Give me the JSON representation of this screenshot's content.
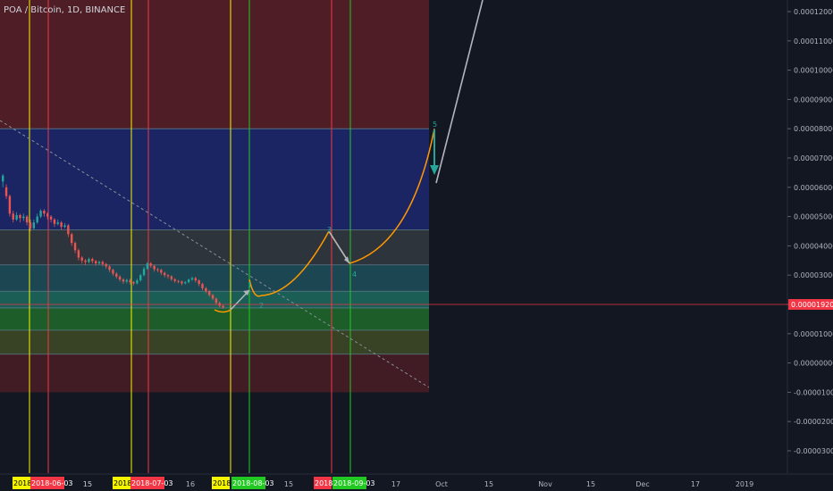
{
  "title": "POA / Bitcoin, 1D, BINANCE",
  "current_price_label": "0.00001920",
  "chart_data": {
    "type": "candlestick",
    "title": "POA / Bitcoin, 1D, BINANCE",
    "ylim": [
      -3.5e-05,
      0.000125
    ],
    "y_ticks": [
      {
        "value": 0.00012,
        "label": "0.00012000"
      },
      {
        "value": 0.00011,
        "label": "0.00011000"
      },
      {
        "value": 0.0001,
        "label": "0.00010000"
      },
      {
        "value": 9e-05,
        "label": "0.00009000"
      },
      {
        "value": 8e-05,
        "label": "0.00008000"
      },
      {
        "value": 7e-05,
        "label": "0.00007000"
      },
      {
        "value": 6e-05,
        "label": "0.00006000"
      },
      {
        "value": 5e-05,
        "label": "0.00005000"
      },
      {
        "value": 4e-05,
        "label": "0.00004000"
      },
      {
        "value": 3e-05,
        "label": "0.00003000"
      },
      {
        "value": 2e-05,
        "label": "0.00002000"
      },
      {
        "value": 1e-05,
        "label": "0.00001000"
      },
      {
        "value": 0.0,
        "label": "0.00000000"
      },
      {
        "value": -1e-05,
        "label": "-0.00001000"
      },
      {
        "value": -2e-05,
        "label": "-0.00002000"
      },
      {
        "value": -3e-05,
        "label": "-0.00003000"
      }
    ],
    "x_ticks": [
      "15",
      "15",
      "16",
      "15",
      "17",
      "Oct",
      "15",
      "Nov",
      "15",
      "Dec",
      "17",
      "2019"
    ],
    "date_chips": [
      {
        "label": "2018-",
        "color": "#f5f500",
        "text_color": "#000000"
      },
      {
        "label": "2018-06-03",
        "color": "#f23645",
        "text_color": "#ffffff"
      },
      {
        "label": "2018-",
        "color": "#f5f500",
        "text_color": "#000000"
      },
      {
        "label": "2018-07-03",
        "color": "#f23645",
        "text_color": "#ffffff"
      },
      {
        "label": "2018-",
        "color": "#f5f500",
        "text_color": "#000000"
      },
      {
        "label": "2018-08-03",
        "color": "#22c922",
        "text_color": "#ffffff"
      },
      {
        "label": "2018-",
        "color": "#f23645",
        "text_color": "#ffffff"
      },
      {
        "label": "2018-09-03",
        "color": "#22c922",
        "text_color": "#ffffff"
      }
    ],
    "zones": [
      {
        "from": 8e-05,
        "to": 0.000125,
        "color": "#5a1f26"
      },
      {
        "from": 4.55e-05,
        "to": 8e-05,
        "color": "#1f2870"
      },
      {
        "from": 3.35e-05,
        "to": 4.55e-05,
        "color": "#34393f"
      },
      {
        "from": 2.45e-05,
        "to": 3.35e-05,
        "color": "#1e4f5a"
      },
      {
        "from": 1.88e-05,
        "to": 2.45e-05,
        "color": "#1c6b5f"
      },
      {
        "from": 1.12e-05,
        "to": 1.88e-05,
        "color": "#1f6a2a"
      },
      {
        "from": 3e-06,
        "to": 1.12e-05,
        "color": "#3f4a25"
      },
      {
        "from": -1e-05,
        "to": 3e-06,
        "color": "#4a1d24"
      }
    ],
    "zone_lines": [
      8e-05,
      4.55e-05,
      3.35e-05,
      2.45e-05,
      1.88e-05,
      1.12e-05,
      3e-06
    ],
    "candles": [
      [
        6.2e-05,
        6.4e-05,
        6e-05,
        6.45e-05
      ],
      [
        6e-05,
        5.7e-05,
        5.6e-05,
        6.1e-05
      ],
      [
        5.7e-05,
        5.1e-05,
        5e-05,
        5.75e-05
      ],
      [
        5.1e-05,
        4.9e-05,
        4.8e-05,
        5.2e-05
      ],
      [
        4.9e-05,
        5.05e-05,
        4.85e-05,
        5.15e-05
      ],
      [
        5.05e-05,
        4.95e-05,
        4.8e-05,
        5.1e-05
      ],
      [
        4.95e-05,
        5e-05,
        4.85e-05,
        5.1e-05
      ],
      [
        5e-05,
        4.8e-05,
        4.7e-05,
        5.05e-05
      ],
      [
        4.8e-05,
        4.6e-05,
        4.5e-05,
        4.9e-05
      ],
      [
        4.6e-05,
        4.8e-05,
        4.55e-05,
        4.9e-05
      ],
      [
        4.8e-05,
        5e-05,
        4.75e-05,
        5.1e-05
      ],
      [
        5e-05,
        5.2e-05,
        4.95e-05,
        5.25e-05
      ],
      [
        5.2e-05,
        5.1e-05,
        5e-05,
        5.25e-05
      ],
      [
        5.1e-05,
        5e-05,
        4.9e-05,
        5.15e-05
      ],
      [
        5e-05,
        4.9e-05,
        4.8e-05,
        5.05e-05
      ],
      [
        4.9e-05,
        4.75e-05,
        4.65e-05,
        4.95e-05
      ],
      [
        4.75e-05,
        4.8e-05,
        4.7e-05,
        4.9e-05
      ],
      [
        4.8e-05,
        4.65e-05,
        4.55e-05,
        4.85e-05
      ],
      [
        4.65e-05,
        4.7e-05,
        4.6e-05,
        4.78e-05
      ],
      [
        4.7e-05,
        4.4e-05,
        4.3e-05,
        4.75e-05
      ],
      [
        4.4e-05,
        4.1e-05,
        4e-05,
        4.45e-05
      ],
      [
        4.1e-05,
        3.85e-05,
        3.75e-05,
        4.15e-05
      ],
      [
        3.85e-05,
        3.6e-05,
        3.5e-05,
        3.9e-05
      ],
      [
        3.6e-05,
        3.5e-05,
        3.4e-05,
        3.65e-05
      ],
      [
        3.5e-05,
        3.45e-05,
        3.35e-05,
        3.55e-05
      ],
      [
        3.45e-05,
        3.55e-05,
        3.4e-05,
        3.6e-05
      ],
      [
        3.55e-05,
        3.48e-05,
        3.4e-05,
        3.6e-05
      ],
      [
        3.48e-05,
        3.4e-05,
        3.32e-05,
        3.52e-05
      ],
      [
        3.4e-05,
        3.45e-05,
        3.35e-05,
        3.5e-05
      ],
      [
        3.45e-05,
        3.38e-05,
        3.3e-05,
        3.5e-05
      ],
      [
        3.38e-05,
        3.3e-05,
        3.22e-05,
        3.42e-05
      ],
      [
        3.3e-05,
        3.18e-05,
        3.1e-05,
        3.34e-05
      ],
      [
        3.18e-05,
        3.05e-05,
        2.98e-05,
        3.22e-05
      ],
      [
        3.05e-05,
        2.95e-05,
        2.88e-05,
        3.1e-05
      ],
      [
        2.95e-05,
        2.85e-05,
        2.78e-05,
        3e-05
      ],
      [
        2.85e-05,
        2.78e-05,
        2.7e-05,
        2.9e-05
      ],
      [
        2.78e-05,
        2.83e-05,
        2.72e-05,
        2.88e-05
      ],
      [
        2.83e-05,
        2.76e-05,
        2.68e-05,
        2.88e-05
      ],
      [
        2.76e-05,
        2.72e-05,
        2.65e-05,
        2.8e-05
      ],
      [
        2.72e-05,
        2.82e-05,
        2.68e-05,
        2.88e-05
      ],
      [
        2.82e-05,
        3e-05,
        2.78e-05,
        3.05e-05
      ],
      [
        3e-05,
        3.22e-05,
        2.96e-05,
        3.28e-05
      ],
      [
        3.22e-05,
        3.4e-05,
        3.18e-05,
        3.45e-05
      ],
      [
        3.4e-05,
        3.32e-05,
        3.25e-05,
        3.45e-05
      ],
      [
        3.32e-05,
        3.2e-05,
        3.12e-05,
        3.36e-05
      ],
      [
        3.2e-05,
        3.18e-05,
        3.1e-05,
        3.25e-05
      ],
      [
        3.18e-05,
        3.08e-05,
        3e-05,
        3.22e-05
      ],
      [
        3.08e-05,
        3e-05,
        2.92e-05,
        3.12e-05
      ],
      [
        3e-05,
        2.96e-05,
        2.88e-05,
        3.04e-05
      ],
      [
        2.96e-05,
        2.86e-05,
        2.8e-05,
        3e-05
      ],
      [
        2.86e-05,
        2.8e-05,
        2.74e-05,
        2.9e-05
      ],
      [
        2.8e-05,
        2.78e-05,
        2.72e-05,
        2.84e-05
      ],
      [
        2.78e-05,
        2.72e-05,
        2.65e-05,
        2.82e-05
      ],
      [
        2.72e-05,
        2.76e-05,
        2.68e-05,
        2.8e-05
      ],
      [
        2.76e-05,
        2.85e-05,
        2.72e-05,
        2.88e-05
      ],
      [
        2.85e-05,
        2.9e-05,
        2.8e-05,
        2.95e-05
      ],
      [
        2.9e-05,
        2.82e-05,
        2.75e-05,
        2.94e-05
      ],
      [
        2.82e-05,
        2.7e-05,
        2.62e-05,
        2.86e-05
      ],
      [
        2.7e-05,
        2.55e-05,
        2.48e-05,
        2.74e-05
      ],
      [
        2.55e-05,
        2.45e-05,
        2.38e-05,
        2.6e-05
      ],
      [
        2.45e-05,
        2.32e-05,
        2.26e-05,
        2.5e-05
      ],
      [
        2.32e-05,
        2.2e-05,
        2.14e-05,
        2.36e-05
      ],
      [
        2.2e-05,
        2.05e-05,
        1.98e-05,
        2.24e-05
      ],
      [
        2.05e-05,
        1.95e-05,
        1.9e-05,
        2.1e-05
      ],
      [
        1.95e-05,
        1.9e-05,
        1.85e-05,
        2e-05
      ]
    ],
    "projection_path": [
      {
        "x": "2018-08-03",
        "y": 2.05e-05
      },
      {
        "x": "2018-08-13",
        "y": 2.85e-05
      },
      {
        "x": "2018-08-18",
        "y": 2.3e-05
      },
      {
        "x": "2018-09-01",
        "y": 4.5e-05
      },
      {
        "x": "2018-09-06",
        "y": 3.4e-05
      },
      {
        "x": "2018-09-27",
        "y": 8e-05
      }
    ],
    "wave_labels": [
      "1",
      "2",
      "3",
      "4",
      "5"
    ]
  }
}
